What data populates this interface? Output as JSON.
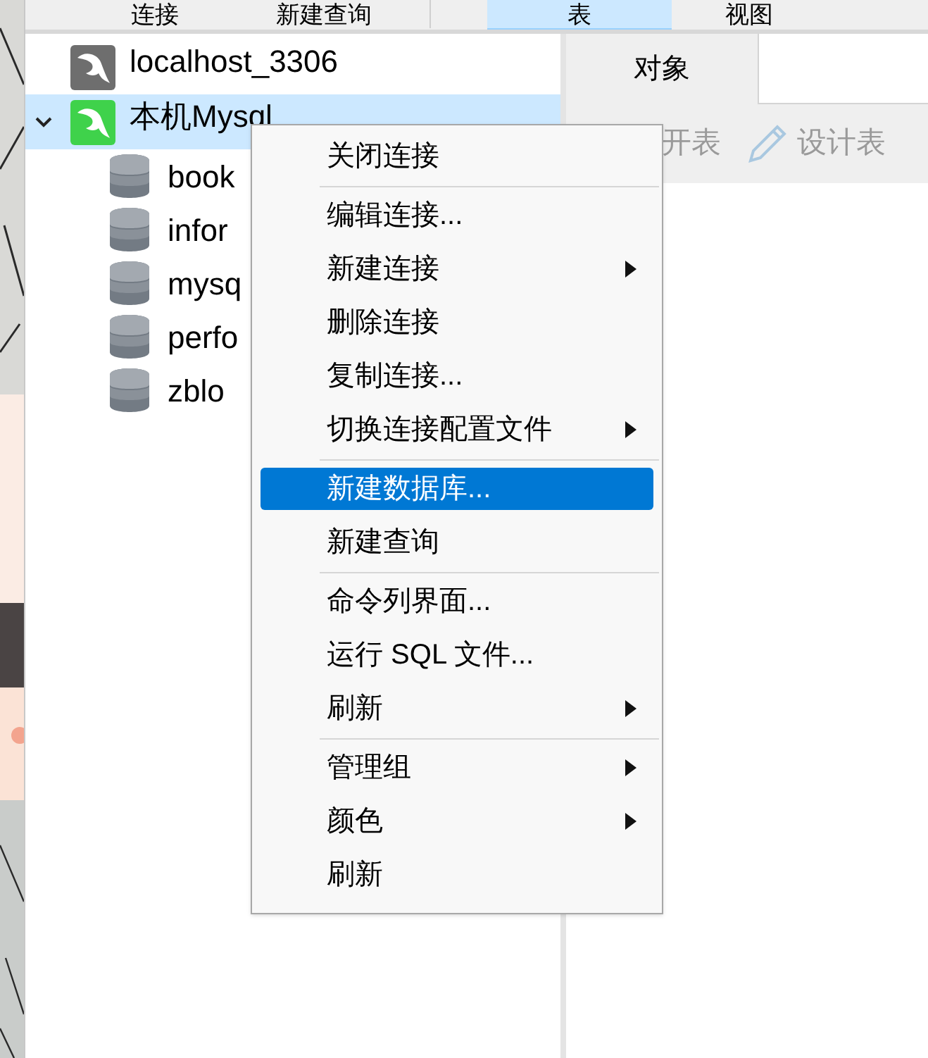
{
  "toolbar": [
    {
      "label": "连接",
      "selected": false
    },
    {
      "label": "新建查询",
      "selected": false
    },
    {
      "label": "表",
      "selected": true
    },
    {
      "label": "视图",
      "selected": false
    }
  ],
  "connections": [
    {
      "name": "localhost_3306",
      "connected": false,
      "selected": false
    },
    {
      "name": "本机Mysql",
      "connected": true,
      "selected": true,
      "expanded": true,
      "children": [
        {
          "name": "book"
        },
        {
          "name": "infor"
        },
        {
          "name": "mysq"
        },
        {
          "name": "perfo"
        },
        {
          "name": "zblo"
        }
      ]
    }
  ],
  "object_tabs": [
    {
      "label": "对象",
      "selected": true
    }
  ],
  "object_actions": [
    {
      "kind": "text",
      "label": "开表",
      "disabled": true
    },
    {
      "kind": "pencil",
      "label": "设计表",
      "disabled": true
    }
  ],
  "context_menu": [
    {
      "kind": "item",
      "label": "关闭连接",
      "submenu": false,
      "selected": false
    },
    {
      "kind": "separator"
    },
    {
      "kind": "item",
      "label": "编辑连接...",
      "submenu": false,
      "selected": false
    },
    {
      "kind": "item",
      "label": "新建连接",
      "submenu": true,
      "selected": false
    },
    {
      "kind": "item",
      "label": "删除连接",
      "submenu": false,
      "selected": false
    },
    {
      "kind": "item",
      "label": "复制连接...",
      "submenu": false,
      "selected": false
    },
    {
      "kind": "item",
      "label": "切换连接配置文件",
      "submenu": true,
      "selected": false
    },
    {
      "kind": "separator"
    },
    {
      "kind": "item",
      "label": "新建数据库...",
      "submenu": false,
      "selected": true
    },
    {
      "kind": "item",
      "label": "新建查询",
      "submenu": false,
      "selected": false
    },
    {
      "kind": "separator"
    },
    {
      "kind": "item",
      "label": "命令列界面...",
      "submenu": false,
      "selected": false
    },
    {
      "kind": "item",
      "label": "运行 SQL 文件...",
      "submenu": false,
      "selected": false
    },
    {
      "kind": "item",
      "label": "刷新",
      "submenu": true,
      "selected": false
    },
    {
      "kind": "separator"
    },
    {
      "kind": "item",
      "label": "管理组",
      "submenu": true,
      "selected": false
    },
    {
      "kind": "item",
      "label": "颜色",
      "submenu": true,
      "selected": false
    },
    {
      "kind": "item",
      "label": "刷新",
      "submenu": false,
      "selected": false
    }
  ]
}
